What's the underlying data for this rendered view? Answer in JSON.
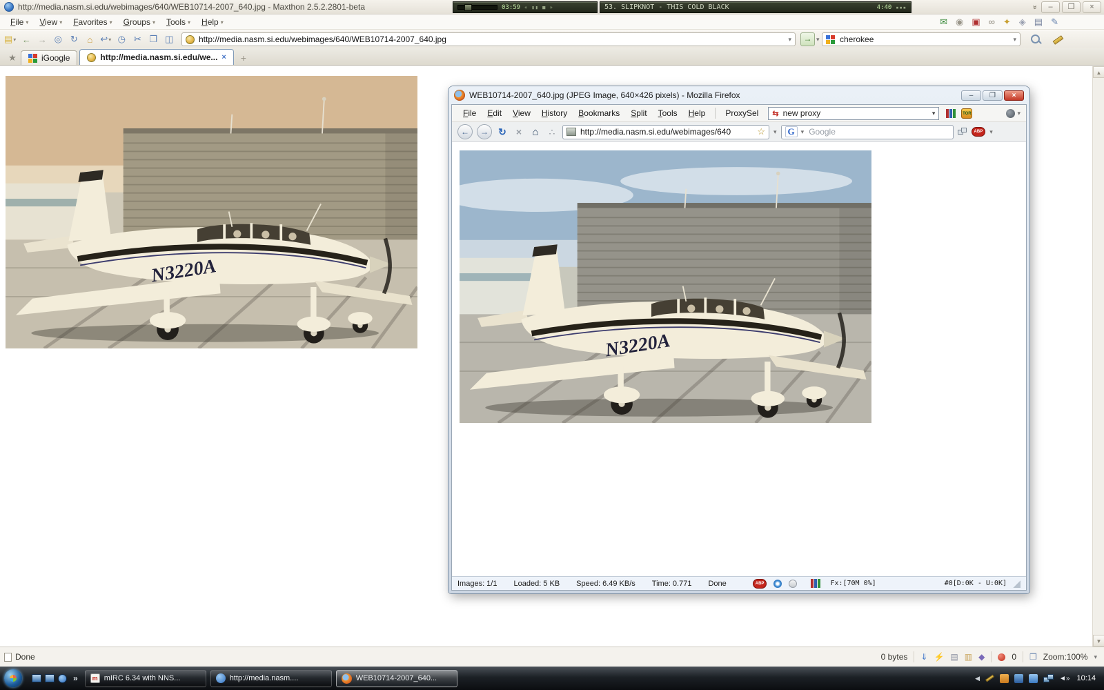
{
  "maxthon": {
    "title": "http://media.nasm.si.edu/webimages/640/WEB10714-2007_640.jpg - Maxthon 2.5.2.2801-beta",
    "menu": {
      "items": [
        "File",
        "View",
        "Favorites",
        "Groups",
        "Tools",
        "Help"
      ]
    },
    "address_url": "http://media.nasm.si.edu/webimages/640/WEB10714-2007_640.jpg",
    "search_value": "cherokee",
    "tabs": [
      {
        "label": "iGoogle"
      },
      {
        "label": "http://media.nasm.si.edu/we..."
      }
    ],
    "status": {
      "left": "Done",
      "bytes": "0 bytes",
      "popup_count": "0",
      "zoom": "Zoom:100%"
    }
  },
  "player": {
    "elapsed": "03:59",
    "track": "53. SLIPKNOT - THIS COLD BLACK",
    "duration": "4:40",
    "controls": "« ▮▮ ■ »"
  },
  "firefox": {
    "title": "WEB10714-2007_640.jpg (JPEG Image, 640×426 pixels) - Mozilla Firefox",
    "menu": {
      "items": [
        "File",
        "Edit",
        "View",
        "History",
        "Bookmarks",
        "Split",
        "Tools",
        "Help"
      ]
    },
    "proxysel_label": "ProxySel",
    "proxy_value": "new proxy",
    "tor_label": "TOR",
    "abp_label": "ABP",
    "url": "http://media.nasm.si.edu/webimages/640",
    "search_placeholder": "Google",
    "status": {
      "images": "Images: 1/1",
      "loaded": "Loaded: 5 KB",
      "speed": "Speed: 6.49 KB/s",
      "time": "Time: 0.771",
      "state": "Done",
      "fx": "Fx:[70M  0%]",
      "net": "#0[D:0K - U:0K]"
    }
  },
  "photo": {
    "registration": "N3220A"
  },
  "taskbar": {
    "buttons": [
      {
        "label": "mIRC 6.34 with NNS..."
      },
      {
        "label": "http://media.nasm...."
      },
      {
        "label": "WEB10714-2007_640..."
      }
    ],
    "clock": "10:14"
  },
  "glyphs": {
    "menu_caret": "▾",
    "dropdown": "▾",
    "new_page": "▤",
    "back": "←",
    "forward": "→",
    "stop_circle": "◎",
    "refresh": "↻",
    "home": "⌂",
    "undo": "↩",
    "clock": "◷",
    "cut": "✂",
    "window": "❐",
    "split": "◫",
    "go": "→",
    "star": "★",
    "star_outline": "☆",
    "close": "×",
    "plus": "+",
    "minimize": "–",
    "restore": "❐",
    "chevron_double": "»",
    "scroll_up": "▲",
    "scroll_down": "▼",
    "mail": "✉",
    "mouse": "◉",
    "image": "▣",
    "links": "∞",
    "key": "✦",
    "disk": "◈",
    "printer": "▤",
    "notes": "✎",
    "ff_back": "←",
    "ff_forward": "→",
    "ff_refresh": "↻",
    "ff_stop": "×",
    "ff_home": "⌂",
    "paw": "∴",
    "proxy_icon": "⇆",
    "dl": "⇓",
    "bolt": "⚡",
    "print2": "▤",
    "folder": "▥",
    "gem": "◆",
    "external": "❒",
    "ql_chevron": "»",
    "tray_chevron": "◀",
    "speaker": "◄»"
  }
}
